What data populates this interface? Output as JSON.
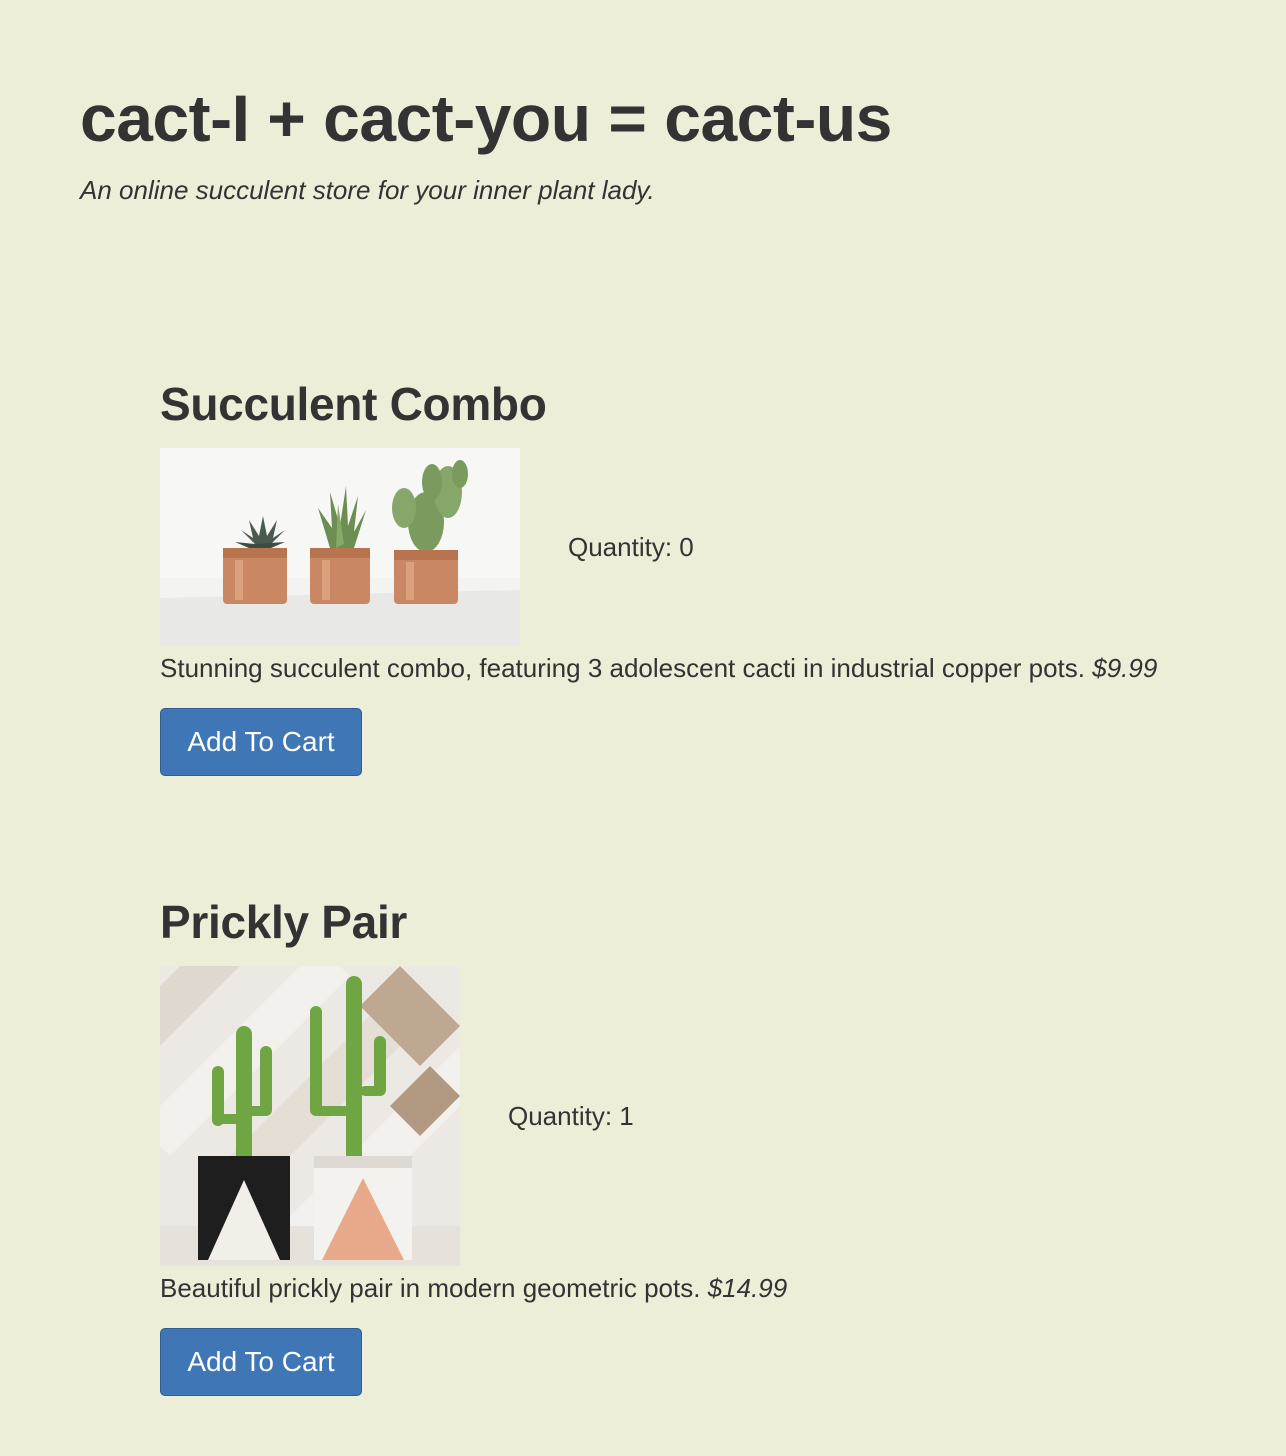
{
  "header": {
    "title": "cact-I + cact-you = cact-us",
    "tagline": "An online succulent store for your inner plant lady."
  },
  "products": [
    {
      "name": "Succulent Combo",
      "quantity_label": "Quantity:",
      "quantity": "0",
      "description": "Stunning succulent combo, featuring 3 adolescent cacti in industrial copper pots.",
      "price": "$9.99",
      "button_label": "Add To Cart"
    },
    {
      "name": "Prickly Pair",
      "quantity_label": "Quantity:",
      "quantity": "1",
      "description": "Beautiful prickly pair in modern geometric pots.",
      "price": "$14.99",
      "button_label": "Add To Cart"
    }
  ],
  "colors": {
    "background": "#edeed8",
    "text": "#333333",
    "button": "#3e76b6"
  }
}
